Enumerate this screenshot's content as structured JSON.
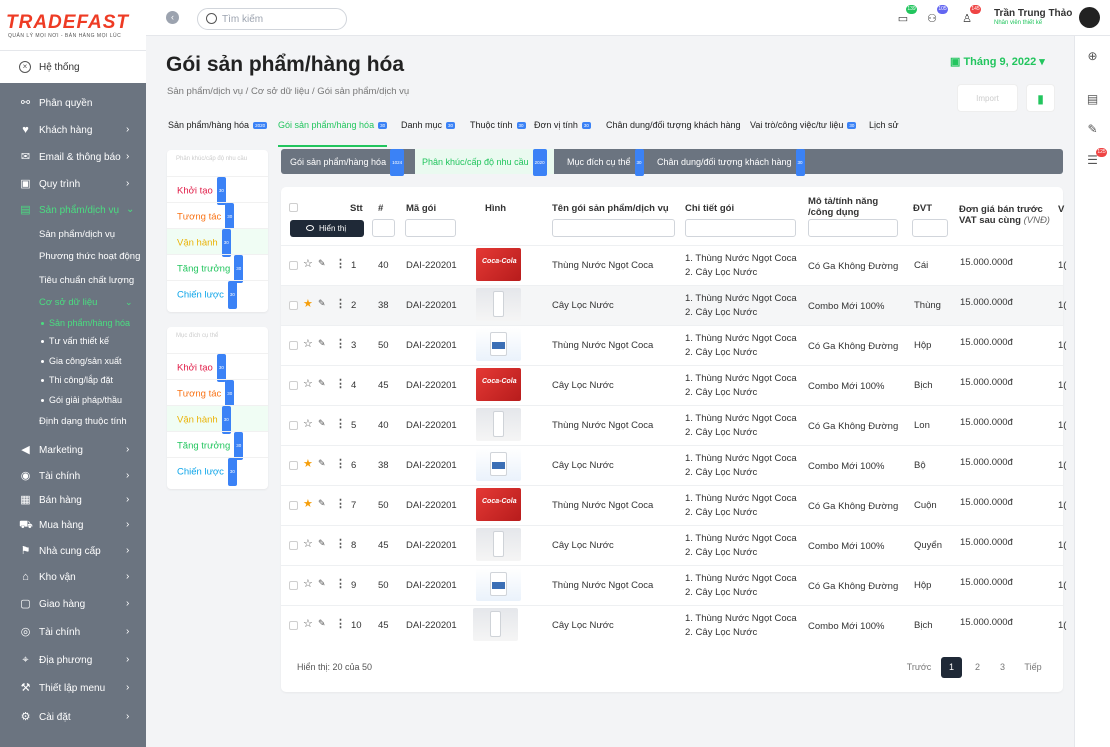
{
  "brand": {
    "name": "TRADEFAST",
    "tagline": "QUẢN LÝ MỌI NƠI - BÁN HÀNG MỌI LÚC"
  },
  "sidebar": {
    "system": "Hệ thống",
    "items": [
      {
        "label": "Phân quyền",
        "icon": "permission-icon",
        "chevron": false
      },
      {
        "label": "Khách hàng",
        "icon": "customer-icon",
        "chevron": true
      },
      {
        "label": "Email & thông báo",
        "icon": "mail-icon",
        "chevron": true
      },
      {
        "label": "Quy trình",
        "icon": "process-icon",
        "chevron": true
      },
      {
        "label": "Sản phẩm/dịch vụ",
        "icon": "product-icon",
        "chevron": true
      },
      {
        "label": "Marketing",
        "icon": "megaphone-icon",
        "chevron": true
      },
      {
        "label": "Tài chính",
        "icon": "finance-icon",
        "chevron": true
      },
      {
        "label": "Bán hàng",
        "icon": "sales-icon",
        "chevron": true
      },
      {
        "label": "Mua hàng",
        "icon": "cart-icon",
        "chevron": true
      },
      {
        "label": "Nhà cung cấp",
        "icon": "supplier-icon",
        "chevron": true
      },
      {
        "label": "Kho vận",
        "icon": "warehouse-icon",
        "chevron": true
      },
      {
        "label": "Giao hàng",
        "icon": "delivery-icon",
        "chevron": true
      },
      {
        "label": "Tài chính",
        "icon": "money-icon",
        "chevron": true
      },
      {
        "label": "Địa phương",
        "icon": "location-icon",
        "chevron": true
      },
      {
        "label": "Thiết lập menu",
        "icon": "wrench-icon",
        "chevron": true
      },
      {
        "label": "Cài đặt",
        "icon": "settings-icon",
        "chevron": true
      }
    ],
    "sub": {
      "s1": "Sản phẩm/dịch vụ",
      "s2": "Phương thức hoạt động",
      "s3": "Tiêu chuẩn chất lượng",
      "s4": "Cơ sở dữ liệu",
      "d1": "Sản phẩm/hàng hóa",
      "d2": "Tư vấn thiết kế",
      "d3": "Gia công/sản xuất",
      "d4": "Thi công/lắp đặt",
      "d5": "Gói giải pháp/thầu",
      "s5": "Định dạng thuộc tính"
    }
  },
  "topbar": {
    "search_placeholder": "Tìm kiếm",
    "badges": {
      "chat": "139",
      "group": "105",
      "alert": "145"
    },
    "user_name": "Trần Trung Thảo",
    "user_role": "Nhân viên thiết kế"
  },
  "page": {
    "title": "Gói sản phẩm/hàng hóa",
    "breadcrumb": "Sản phẩm/dịch vụ  /  Cơ sở dữ liệu  /  Gói sản phẩm/dịch vụ",
    "month": "Tháng 9, 2022",
    "import_label": "Import"
  },
  "tabs": [
    {
      "label": "Sản phẩm/hàng hóa",
      "count": "2020"
    },
    {
      "label": "Gói sản phẩm/hàng hóa",
      "count": "30"
    },
    {
      "label": "Danh mục",
      "count": "30"
    },
    {
      "label": "Thuộc tính",
      "count": "30"
    },
    {
      "label": "Đơn vị tính",
      "count": "30"
    },
    {
      "label": "Chân dung/đối tượng khách hàng",
      "count": ""
    },
    {
      "label": "Vai trò/công việc/tư liệu",
      "count": "30"
    },
    {
      "label": "Lịch sử",
      "count": ""
    }
  ],
  "panels": [
    {
      "head": "Phân khúc/cấp độ nhu cầu",
      "items": [
        {
          "label": "Khởi tạo",
          "count": "30",
          "color": "#e11d48"
        },
        {
          "label": "Tương tác",
          "count": "30",
          "color": "#f97316"
        },
        {
          "label": "Vận hành",
          "count": "30",
          "color": "#eab308"
        },
        {
          "label": "Tăng trưởng",
          "count": "30",
          "color": "#22c55e"
        },
        {
          "label": "Chiến lược",
          "count": "30",
          "color": "#0ea5e9"
        }
      ]
    },
    {
      "head": "Mục đích cụ thể",
      "items": [
        {
          "label": "Khởi tạo",
          "count": "30",
          "color": "#e11d48"
        },
        {
          "label": "Tương tác",
          "count": "30",
          "color": "#f97316"
        },
        {
          "label": "Vận hành",
          "count": "30",
          "color": "#eab308"
        },
        {
          "label": "Tăng trưởng",
          "count": "30",
          "color": "#22c55e"
        },
        {
          "label": "Chiến lược",
          "count": "30",
          "color": "#0ea5e9"
        }
      ]
    }
  ],
  "subtabs": [
    {
      "label": "Gói sản phẩm/hàng hóa",
      "count": "1024"
    },
    {
      "label": "Phân khúc/cấp độ nhu cầu",
      "count": "2020"
    },
    {
      "label": "Mục đích cụ thể",
      "count": "30"
    },
    {
      "label": "Chân dung/đối tượng khách hàng",
      "count": "30"
    }
  ],
  "table": {
    "show_label": "Hiển thị",
    "headers": {
      "stt": "Stt",
      "num": "#",
      "code": "Mã gói",
      "image": "Hình",
      "name": "Tên gói sản phẩm/dịch vụ",
      "detail": "Chi tiết gói",
      "desc1": "Mô tả/tính năng",
      "desc2": "/công dụng",
      "unit": "ĐVT",
      "price1": "Đơn giá bán trước",
      "price2": "VAT sau cùng",
      "price_unit": "(VNĐ)",
      "extra": "V"
    },
    "rows": [
      {
        "stt": "1",
        "num": "40",
        "code": "DAI-220201",
        "img": "coca",
        "name": "Thùng Nước Ngọt Coca",
        "d1": "1. Thùng Nước Ngọt Coca",
        "d2": "2. Cây Lọc Nước",
        "desc": "Có Ga Không Đường",
        "unit": "Cái",
        "price": "15.000.000đ",
        "extra": "1(",
        "starred": false
      },
      {
        "stt": "2",
        "num": "38",
        "code": "DAI-220201",
        "img": "water",
        "name": "Cây Lọc Nước",
        "d1": "1. Thùng Nước Ngọt Coca",
        "d2": "2. Cây Lọc Nước",
        "desc": "Combo Mới 100%",
        "unit": "Thùng",
        "price": "15.000.000đ",
        "extra": "1(",
        "starred": true
      },
      {
        "stt": "3",
        "num": "50",
        "code": "DAI-220201",
        "img": "paint",
        "name": "Thùng Nước Ngọt Coca",
        "d1": "1. Thùng Nước Ngọt Coca",
        "d2": "2. Cây Lọc Nước",
        "desc": "Có Ga Không Đường",
        "unit": "Hộp",
        "price": "15.000.000đ",
        "extra": "1(",
        "starred": false
      },
      {
        "stt": "4",
        "num": "45",
        "code": "DAI-220201",
        "img": "coca",
        "name": "Cây Lọc Nước",
        "d1": "1. Thùng Nước Ngọt Coca",
        "d2": "2. Cây Lọc Nước",
        "desc": "Combo Mới 100%",
        "unit": "Bịch",
        "price": "15.000.000đ",
        "extra": "1(",
        "starred": false
      },
      {
        "stt": "5",
        "num": "40",
        "code": "DAI-220201",
        "img": "water",
        "name": "Thùng Nước Ngọt Coca",
        "d1": "1. Thùng Nước Ngọt Coca",
        "d2": "2. Cây Lọc Nước",
        "desc": "Có Ga Không Đường",
        "unit": "Lon",
        "price": "15.000.000đ",
        "extra": "1(",
        "starred": false
      },
      {
        "stt": "6",
        "num": "38",
        "code": "DAI-220201",
        "img": "paint",
        "name": "Cây Lọc Nước",
        "d1": "1. Thùng Nước Ngọt Coca",
        "d2": "2. Cây Lọc Nước",
        "desc": "Combo Mới 100%",
        "unit": "Bộ",
        "price": "15.000.000đ",
        "extra": "1(",
        "starred": true
      },
      {
        "stt": "7",
        "num": "50",
        "code": "DAI-220201",
        "img": "coca",
        "name": "Thùng Nước Ngọt Coca",
        "d1": "1. Thùng Nước Ngọt Coca",
        "d2": "2. Cây Lọc Nước",
        "desc": "Có Ga Không Đường",
        "unit": "Cuộn",
        "price": "15.000.000đ",
        "extra": "1(",
        "starred": true
      },
      {
        "stt": "8",
        "num": "45",
        "code": "DAI-220201",
        "img": "water",
        "name": "Cây Lọc Nước",
        "d1": "1. Thùng Nước Ngọt Coca",
        "d2": "2. Cây Lọc Nước",
        "desc": "Combo Mới 100%",
        "unit": "Quyển",
        "price": "15.000.000đ",
        "extra": "1(",
        "starred": false
      },
      {
        "stt": "9",
        "num": "50",
        "code": "DAI-220201",
        "img": "paint",
        "name": "Thùng Nước Ngọt Coca",
        "d1": "1. Thùng Nước Ngọt Coca",
        "d2": "2. Cây Lọc Nước",
        "desc": "Có Ga Không Đường",
        "unit": "Hộp",
        "price": "15.000.000đ",
        "extra": "1(",
        "starred": false
      },
      {
        "stt": "10",
        "num": "45",
        "code": "DAI-220201",
        "img": "water",
        "name": "Cây Lọc Nước",
        "d1": "1. Thùng Nước Ngọt Coca",
        "d2": "2. Cây Lọc Nước",
        "desc": "Combo Mới 100%",
        "unit": "Bịch",
        "price": "15.000.000đ",
        "extra": "1(",
        "starred": false
      }
    ],
    "footer": "Hiển thị: 20 của 50",
    "pagination": {
      "prev": "Trước",
      "pages": [
        "1",
        "2",
        "3"
      ],
      "next": "Tiếp"
    }
  },
  "colors": {
    "accent": "#22c55e",
    "sidebar_bg": "#6b7480",
    "brand": "#ee3b24"
  }
}
